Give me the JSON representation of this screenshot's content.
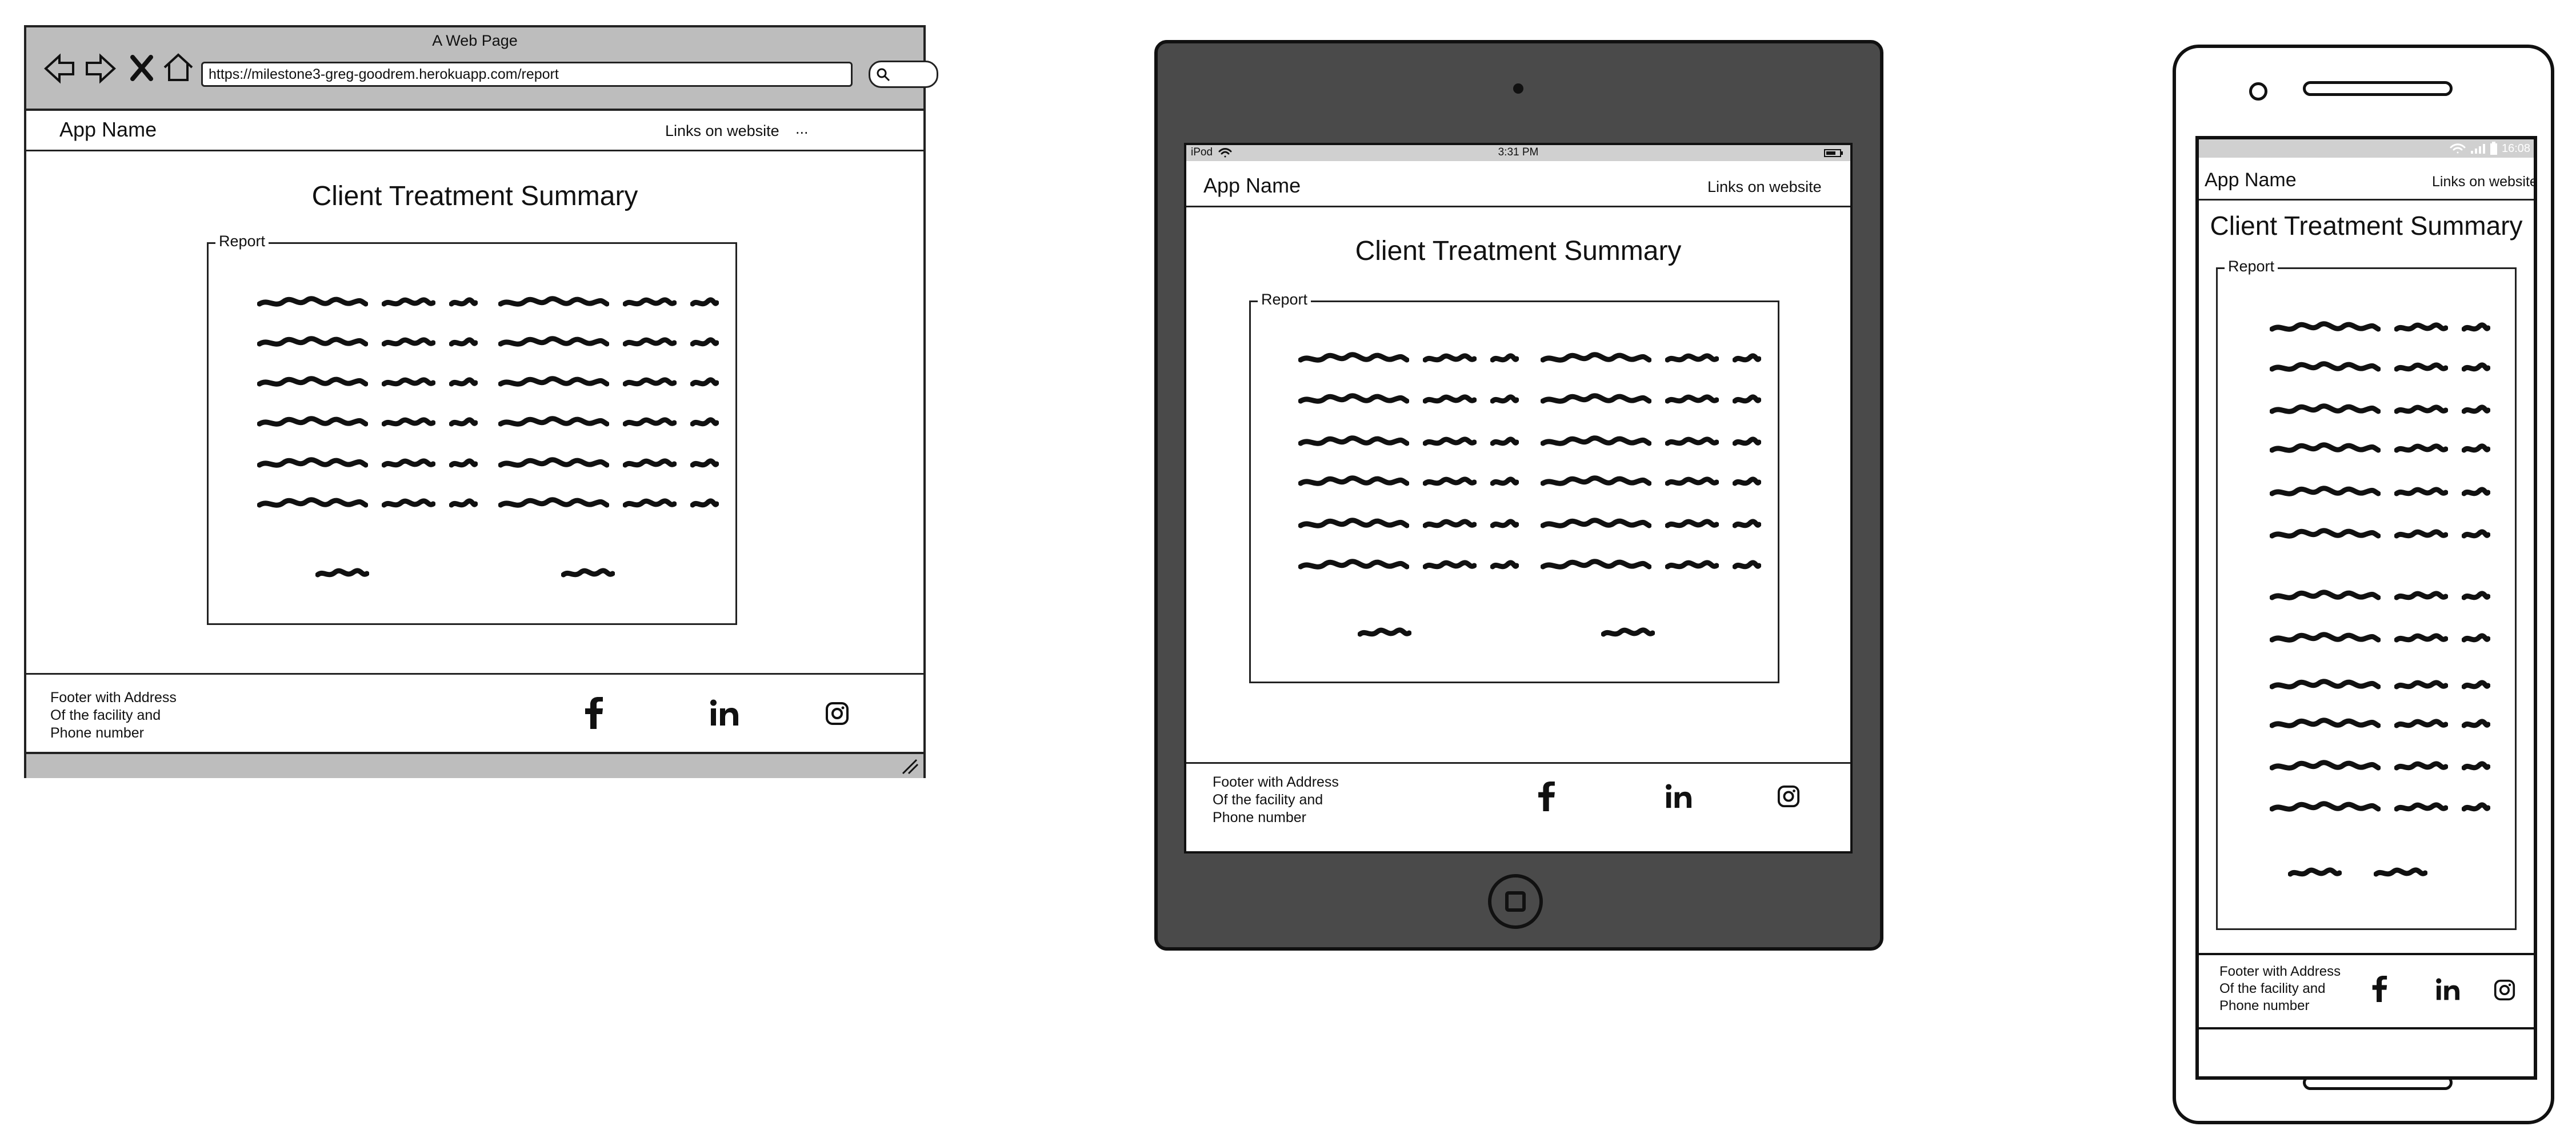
{
  "desktop": {
    "window_title": "A Web Page",
    "url": "https://milestone3-greg-goodrem.herokuapp.com/report",
    "app_name": "App Name",
    "nav_link": "Links on website",
    "nav_more": "...",
    "page_title": "Client Treatment Summary",
    "report_label": "Report",
    "footer_lines": [
      "Footer with Address",
      "Of the facility and",
      "Phone number"
    ]
  },
  "tablet": {
    "status_device": "iPod",
    "status_time": "3:31 PM",
    "app_name": "App Name",
    "nav_link": "Links on website",
    "page_title": "Client Treatment Summary",
    "report_label": "Report",
    "footer_lines": [
      "Footer with Address",
      "Of the facility and",
      "Phone number"
    ]
  },
  "phone": {
    "status_time": "16:08",
    "app_name": "App Name",
    "nav_link": "Links on website",
    "page_title": "Client Treatment Summary",
    "report_label": "Report",
    "footer_lines": [
      "Footer with Address",
      "Of the facility and",
      "Phone number"
    ]
  },
  "icons": {
    "facebook": "facebook-icon",
    "linkedin": "linkedin-icon",
    "instagram": "instagram-icon"
  }
}
